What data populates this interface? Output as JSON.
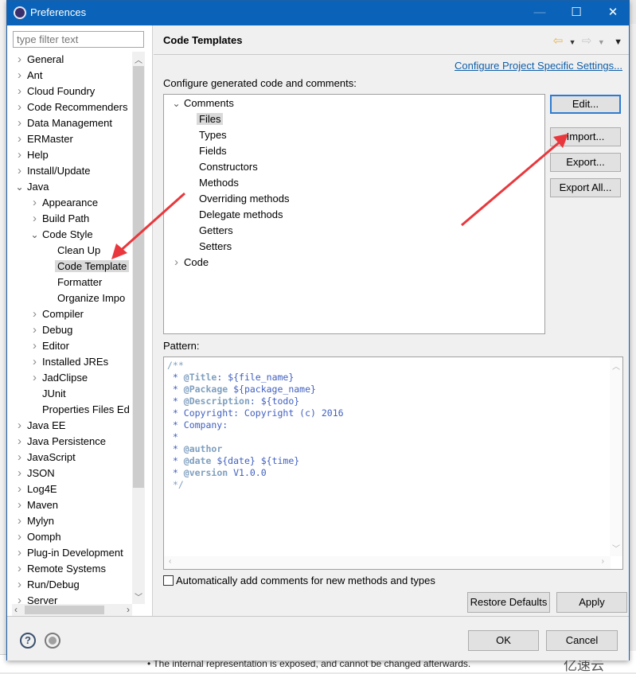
{
  "window": {
    "title": "Preferences",
    "controls": {
      "minimize": "—",
      "maximize": "☐",
      "close": "✕"
    }
  },
  "sidebar": {
    "filter_placeholder": "type filter text",
    "items": [
      {
        "label": "General",
        "level": 0,
        "state": "collapsed"
      },
      {
        "label": "Ant",
        "level": 0,
        "state": "collapsed"
      },
      {
        "label": "Cloud Foundry",
        "level": 0,
        "state": "collapsed"
      },
      {
        "label": "Code Recommenders",
        "level": 0,
        "state": "collapsed"
      },
      {
        "label": "Data Management",
        "level": 0,
        "state": "collapsed"
      },
      {
        "label": "ERMaster",
        "level": 0,
        "state": "collapsed"
      },
      {
        "label": "Help",
        "level": 0,
        "state": "collapsed"
      },
      {
        "label": "Install/Update",
        "level": 0,
        "state": "collapsed"
      },
      {
        "label": "Java",
        "level": 0,
        "state": "expanded"
      },
      {
        "label": "Appearance",
        "level": 1,
        "state": "collapsed"
      },
      {
        "label": "Build Path",
        "level": 1,
        "state": "collapsed"
      },
      {
        "label": "Code Style",
        "level": 1,
        "state": "expanded"
      },
      {
        "label": "Clean Up",
        "level": 2,
        "state": "leaf"
      },
      {
        "label": "Code Template",
        "level": 2,
        "state": "leaf",
        "selected": true
      },
      {
        "label": "Formatter",
        "level": 2,
        "state": "leaf"
      },
      {
        "label": "Organize Impo",
        "level": 2,
        "state": "leaf"
      },
      {
        "label": "Compiler",
        "level": 1,
        "state": "collapsed"
      },
      {
        "label": "Debug",
        "level": 1,
        "state": "collapsed"
      },
      {
        "label": "Editor",
        "level": 1,
        "state": "collapsed"
      },
      {
        "label": "Installed JREs",
        "level": 1,
        "state": "collapsed"
      },
      {
        "label": "JadClipse",
        "level": 1,
        "state": "collapsed"
      },
      {
        "label": "JUnit",
        "level": 1,
        "state": "leaf"
      },
      {
        "label": "Properties Files Ed",
        "level": 1,
        "state": "leaf"
      },
      {
        "label": "Java EE",
        "level": 0,
        "state": "collapsed"
      },
      {
        "label": "Java Persistence",
        "level": 0,
        "state": "collapsed"
      },
      {
        "label": "JavaScript",
        "level": 0,
        "state": "collapsed"
      },
      {
        "label": "JSON",
        "level": 0,
        "state": "collapsed"
      },
      {
        "label": "Log4E",
        "level": 0,
        "state": "collapsed"
      },
      {
        "label": "Maven",
        "level": 0,
        "state": "collapsed"
      },
      {
        "label": "Mylyn",
        "level": 0,
        "state": "collapsed"
      },
      {
        "label": "Oomph",
        "level": 0,
        "state": "collapsed"
      },
      {
        "label": "Plug-in Development",
        "level": 0,
        "state": "collapsed"
      },
      {
        "label": "Remote Systems",
        "level": 0,
        "state": "collapsed"
      },
      {
        "label": "Run/Debug",
        "level": 0,
        "state": "collapsed"
      },
      {
        "label": "Server",
        "level": 0,
        "state": "collapsed"
      }
    ]
  },
  "page": {
    "title": "Code Templates",
    "configure_link": "Configure Project Specific Settings...",
    "configure_label": "Configure generated code and comments:",
    "templates": [
      {
        "label": "Comments",
        "level": 0,
        "state": "expanded"
      },
      {
        "label": "Files",
        "level": 1,
        "state": "leaf",
        "selected": true
      },
      {
        "label": "Types",
        "level": 1,
        "state": "leaf"
      },
      {
        "label": "Fields",
        "level": 1,
        "state": "leaf"
      },
      {
        "label": "Constructors",
        "level": 1,
        "state": "leaf"
      },
      {
        "label": "Methods",
        "level": 1,
        "state": "leaf"
      },
      {
        "label": "Overriding methods",
        "level": 1,
        "state": "leaf"
      },
      {
        "label": "Delegate methods",
        "level": 1,
        "state": "leaf"
      },
      {
        "label": "Getters",
        "level": 1,
        "state": "leaf"
      },
      {
        "label": "Setters",
        "level": 1,
        "state": "leaf"
      },
      {
        "label": "Code",
        "level": 0,
        "state": "collapsed"
      }
    ],
    "buttons": {
      "edit": "Edit...",
      "import": "Import...",
      "export": "Export...",
      "export_all": "Export All..."
    },
    "pattern_label": "Pattern:",
    "pattern_lines": [
      "/**",
      " * @Title: ${file_name}",
      " * @Package ${package_name}",
      " * @Description: ${todo}",
      " * Copyright: Copyright (c) 2016",
      " * Company:",
      " *",
      " * @author",
      " * @date ${date} ${time}",
      " * @version V1.0.0",
      " */"
    ],
    "auto_comments_label": "Automatically add comments for new methods and types",
    "auto_comments_checked": false,
    "restore_defaults": "Restore Defaults",
    "apply": "Apply"
  },
  "footer": {
    "ok": "OK",
    "cancel": "Cancel"
  },
  "background": {
    "bottom_text": "•  The internal representation is exposed, and cannot be changed afterwards.",
    "watermark": "亿速云"
  },
  "colors": {
    "titlebar": "#0a63b8",
    "link": "#0f5ea8",
    "annotation_arrow": "#e8383d",
    "javadoc": "#3f5fbf"
  }
}
